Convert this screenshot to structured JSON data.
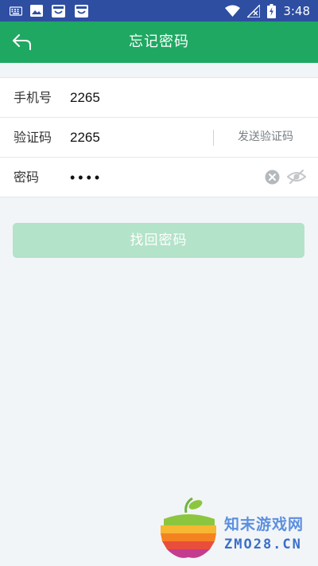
{
  "status_bar": {
    "time": "3:48",
    "left_icons": [
      "keyboard-icon",
      "image-icon",
      "shopping-bag-icon",
      "shopping-bag-icon"
    ],
    "right_icons": [
      "wifi-icon",
      "no-signal-icon",
      "battery-charging-icon"
    ]
  },
  "app_bar": {
    "title": "忘记密码",
    "back_icon": "back-arrow-icon",
    "color": "#1fa862"
  },
  "form": {
    "phone": {
      "label": "手机号",
      "value": "2265"
    },
    "code": {
      "label": "验证码",
      "value": "2265",
      "send_label": "发送验证码"
    },
    "password": {
      "label": "密码",
      "value": "••••",
      "clear_icon": "clear-icon",
      "visibility_icon": "eye-off-icon"
    }
  },
  "submit": {
    "label": "找回密码",
    "color": "#b3e3c9"
  },
  "watermark": {
    "cn": "知末游戏网",
    "en": "ZMO28.CN"
  }
}
